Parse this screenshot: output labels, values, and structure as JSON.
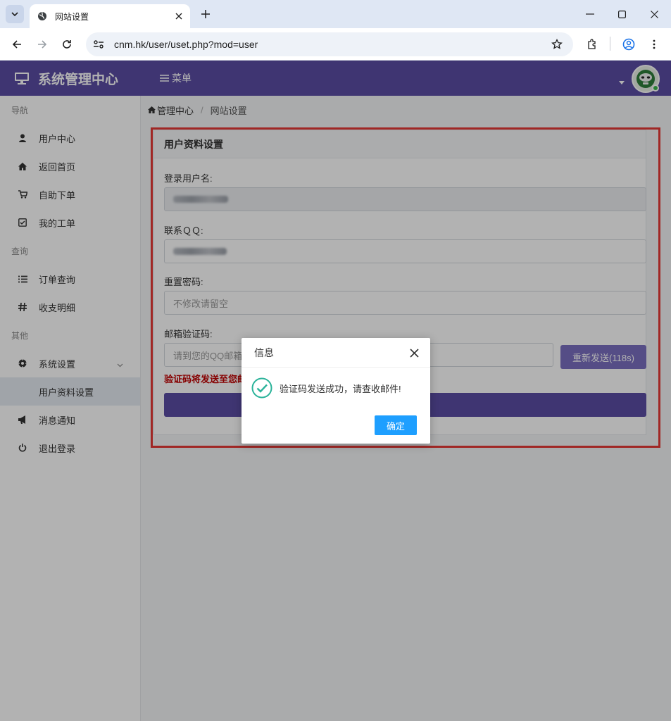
{
  "browser": {
    "tab_title": "网站设置",
    "url": "cnm.hk/user/uset.php?mod=user"
  },
  "topbar": {
    "brand": "系统管理中心",
    "menu_label": "菜单"
  },
  "sidebar": {
    "sections": [
      {
        "label": "导航"
      },
      {
        "label": "查询"
      },
      {
        "label": "其他"
      }
    ],
    "items": [
      {
        "label": "用户中心",
        "icon": "user-icon"
      },
      {
        "label": "返回首页",
        "icon": "home-icon"
      },
      {
        "label": "自助下单",
        "icon": "cart-icon"
      },
      {
        "label": "我的工单",
        "icon": "checkbox-icon"
      },
      {
        "label": "订单查询",
        "icon": "list-icon"
      },
      {
        "label": "收支明细",
        "icon": "hash-icon"
      },
      {
        "label": "系统设置",
        "icon": "gears-icon"
      },
      {
        "label": "用户资料设置"
      },
      {
        "label": "消息通知",
        "icon": "megaphone-icon"
      },
      {
        "label": "退出登录",
        "icon": "power-icon"
      }
    ]
  },
  "breadcrumb": {
    "home": "管理中心",
    "current": "网站设置"
  },
  "panel": {
    "title": "用户资料设置",
    "username_label": "登录用户名:",
    "qq_label": "联系ＱＱ:",
    "password_label": "重置密码:",
    "password_placeholder": "不修改请留空",
    "code_label": "邮箱验证码:",
    "code_placeholder": "请到您的QQ邮箱",
    "resend_label": "重新发送(118s)",
    "hint": "验证码将发送至您邮"
  },
  "modal": {
    "title": "信息",
    "message": "验证码发送成功，请查收邮件!",
    "ok_label": "确定"
  },
  "colors": {
    "brand_purple": "#5b4da4",
    "highlight_red": "#e53935",
    "ok_blue": "#1e9fff",
    "success_teal": "#2bb39a"
  }
}
